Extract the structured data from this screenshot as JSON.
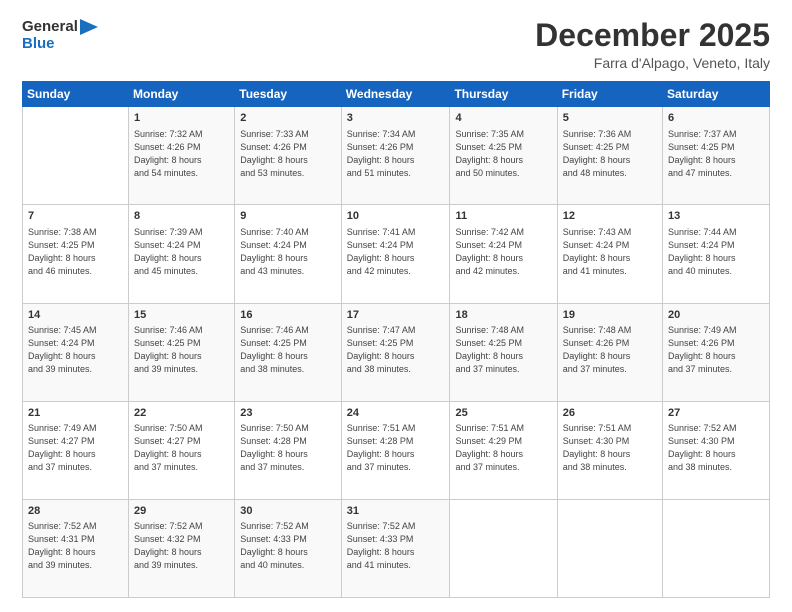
{
  "header": {
    "logo_line1": "General",
    "logo_line2": "Blue",
    "month_title": "December 2025",
    "location": "Farra d'Alpago, Veneto, Italy"
  },
  "weekdays": [
    "Sunday",
    "Monday",
    "Tuesday",
    "Wednesday",
    "Thursday",
    "Friday",
    "Saturday"
  ],
  "weeks": [
    [
      {
        "day": "",
        "info": ""
      },
      {
        "day": "1",
        "info": "Sunrise: 7:32 AM\nSunset: 4:26 PM\nDaylight: 8 hours\nand 54 minutes."
      },
      {
        "day": "2",
        "info": "Sunrise: 7:33 AM\nSunset: 4:26 PM\nDaylight: 8 hours\nand 53 minutes."
      },
      {
        "day": "3",
        "info": "Sunrise: 7:34 AM\nSunset: 4:26 PM\nDaylight: 8 hours\nand 51 minutes."
      },
      {
        "day": "4",
        "info": "Sunrise: 7:35 AM\nSunset: 4:25 PM\nDaylight: 8 hours\nand 50 minutes."
      },
      {
        "day": "5",
        "info": "Sunrise: 7:36 AM\nSunset: 4:25 PM\nDaylight: 8 hours\nand 48 minutes."
      },
      {
        "day": "6",
        "info": "Sunrise: 7:37 AM\nSunset: 4:25 PM\nDaylight: 8 hours\nand 47 minutes."
      }
    ],
    [
      {
        "day": "7",
        "info": "Sunrise: 7:38 AM\nSunset: 4:25 PM\nDaylight: 8 hours\nand 46 minutes."
      },
      {
        "day": "8",
        "info": "Sunrise: 7:39 AM\nSunset: 4:24 PM\nDaylight: 8 hours\nand 45 minutes."
      },
      {
        "day": "9",
        "info": "Sunrise: 7:40 AM\nSunset: 4:24 PM\nDaylight: 8 hours\nand 43 minutes."
      },
      {
        "day": "10",
        "info": "Sunrise: 7:41 AM\nSunset: 4:24 PM\nDaylight: 8 hours\nand 42 minutes."
      },
      {
        "day": "11",
        "info": "Sunrise: 7:42 AM\nSunset: 4:24 PM\nDaylight: 8 hours\nand 42 minutes."
      },
      {
        "day": "12",
        "info": "Sunrise: 7:43 AM\nSunset: 4:24 PM\nDaylight: 8 hours\nand 41 minutes."
      },
      {
        "day": "13",
        "info": "Sunrise: 7:44 AM\nSunset: 4:24 PM\nDaylight: 8 hours\nand 40 minutes."
      }
    ],
    [
      {
        "day": "14",
        "info": "Sunrise: 7:45 AM\nSunset: 4:24 PM\nDaylight: 8 hours\nand 39 minutes."
      },
      {
        "day": "15",
        "info": "Sunrise: 7:46 AM\nSunset: 4:25 PM\nDaylight: 8 hours\nand 39 minutes."
      },
      {
        "day": "16",
        "info": "Sunrise: 7:46 AM\nSunset: 4:25 PM\nDaylight: 8 hours\nand 38 minutes."
      },
      {
        "day": "17",
        "info": "Sunrise: 7:47 AM\nSunset: 4:25 PM\nDaylight: 8 hours\nand 38 minutes."
      },
      {
        "day": "18",
        "info": "Sunrise: 7:48 AM\nSunset: 4:25 PM\nDaylight: 8 hours\nand 37 minutes."
      },
      {
        "day": "19",
        "info": "Sunrise: 7:48 AM\nSunset: 4:26 PM\nDaylight: 8 hours\nand 37 minutes."
      },
      {
        "day": "20",
        "info": "Sunrise: 7:49 AM\nSunset: 4:26 PM\nDaylight: 8 hours\nand 37 minutes."
      }
    ],
    [
      {
        "day": "21",
        "info": "Sunrise: 7:49 AM\nSunset: 4:27 PM\nDaylight: 8 hours\nand 37 minutes."
      },
      {
        "day": "22",
        "info": "Sunrise: 7:50 AM\nSunset: 4:27 PM\nDaylight: 8 hours\nand 37 minutes."
      },
      {
        "day": "23",
        "info": "Sunrise: 7:50 AM\nSunset: 4:28 PM\nDaylight: 8 hours\nand 37 minutes."
      },
      {
        "day": "24",
        "info": "Sunrise: 7:51 AM\nSunset: 4:28 PM\nDaylight: 8 hours\nand 37 minutes."
      },
      {
        "day": "25",
        "info": "Sunrise: 7:51 AM\nSunset: 4:29 PM\nDaylight: 8 hours\nand 37 minutes."
      },
      {
        "day": "26",
        "info": "Sunrise: 7:51 AM\nSunset: 4:30 PM\nDaylight: 8 hours\nand 38 minutes."
      },
      {
        "day": "27",
        "info": "Sunrise: 7:52 AM\nSunset: 4:30 PM\nDaylight: 8 hours\nand 38 minutes."
      }
    ],
    [
      {
        "day": "28",
        "info": "Sunrise: 7:52 AM\nSunset: 4:31 PM\nDaylight: 8 hours\nand 39 minutes."
      },
      {
        "day": "29",
        "info": "Sunrise: 7:52 AM\nSunset: 4:32 PM\nDaylight: 8 hours\nand 39 minutes."
      },
      {
        "day": "30",
        "info": "Sunrise: 7:52 AM\nSunset: 4:33 PM\nDaylight: 8 hours\nand 40 minutes."
      },
      {
        "day": "31",
        "info": "Sunrise: 7:52 AM\nSunset: 4:33 PM\nDaylight: 8 hours\nand 41 minutes."
      },
      {
        "day": "",
        "info": ""
      },
      {
        "day": "",
        "info": ""
      },
      {
        "day": "",
        "info": ""
      }
    ]
  ]
}
